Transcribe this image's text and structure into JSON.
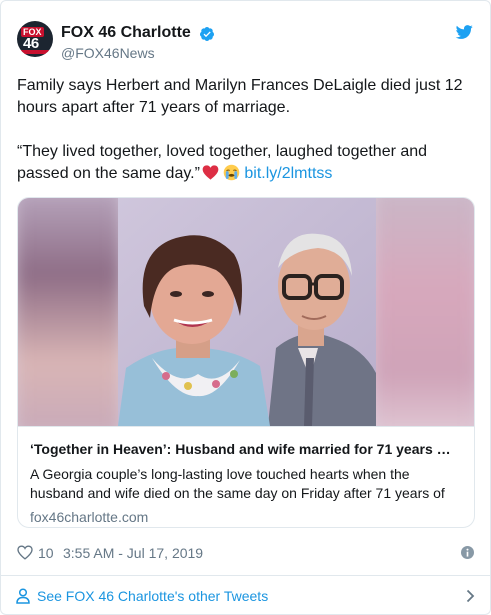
{
  "author": {
    "name": "FOX 46 Charlotte",
    "handle": "@FOX46News",
    "avatar_text": {
      "brand": "FOX",
      "number": "46"
    },
    "verified_icon": "verified-badge-icon"
  },
  "tweet": {
    "paragraph1": "Family says Herbert and Marilyn Frances DeLaigle died just 12 hours apart after 71 years of marriage.",
    "paragraph2": "“They lived together, loved together, laughed together and passed on the same day.”",
    "link": "bit.ly/2lmttss",
    "emojis": [
      "red-heart-emoji",
      "crying-face-emoji"
    ]
  },
  "link_card": {
    "title": "‘Together in Heaven’: Husband and wife married for 71 years …",
    "description": "A Georgia couple’s long-lasting love touched hearts when the husband and wife died on the same day on Friday after 71 years of",
    "domain": "fox46charlotte.com"
  },
  "meta": {
    "likes": "10",
    "timestamp": "3:55 AM - Jul 17, 2019"
  },
  "footer": {
    "link_text": "See FOX 46 Charlotte's other Tweets"
  },
  "colors": {
    "link": "#1b95e0",
    "muted": "#657786",
    "border": "#e1e8ed",
    "twitter_blue": "#1da1f2"
  }
}
